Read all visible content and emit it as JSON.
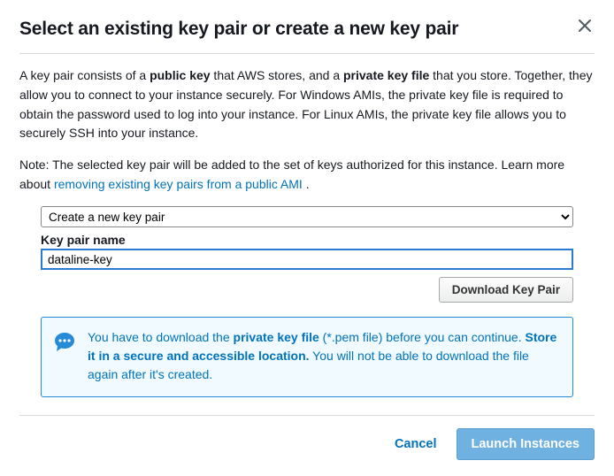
{
  "header": {
    "title": "Select an existing key pair or create a new key pair"
  },
  "description": {
    "pre1": "A key pair consists of a ",
    "bold1": "public key",
    "mid1": " that AWS stores, and a ",
    "bold2": "private key file",
    "post1": " that you store. Together, they allow you to connect to your instance securely. For Windows AMIs, the private key file is required to obtain the password used to log into your instance. For Linux AMIs, the private key file allows you to securely SSH into your instance."
  },
  "note": {
    "text": "Note: The selected key pair will be added to the set of keys authorized for this instance. Learn more about ",
    "link_text": "removing existing key pairs from a public AMI",
    "tail": " ."
  },
  "form": {
    "select_value": "Create a new key pair",
    "name_label": "Key pair name",
    "name_value": "dataline-key",
    "download_label": "Download Key Pair"
  },
  "info": {
    "p1a": "You have to download the ",
    "p1_bold": "private key file",
    "p1b": " (*.pem file) before you can continue. ",
    "p2_bold": "Store it in a secure and accessible location.",
    "p2": " You will not be able to download the file again after it's created."
  },
  "footer": {
    "cancel": "Cancel",
    "launch": "Launch Instances"
  }
}
